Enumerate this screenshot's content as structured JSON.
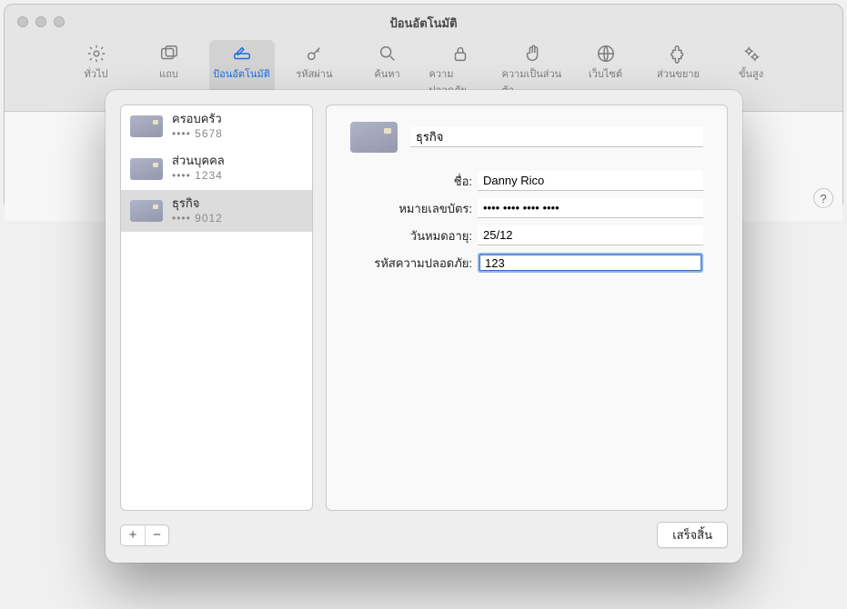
{
  "window": {
    "title": "ป้อนอัตโนมัติ"
  },
  "toolbar": {
    "items": [
      {
        "label": "ทั่วไป"
      },
      {
        "label": "แถบ"
      },
      {
        "label": "ป้อนอัตโนมัติ"
      },
      {
        "label": "รหัสผ่าน"
      },
      {
        "label": "ค้นหา"
      },
      {
        "label": "ความปลอดภัย"
      },
      {
        "label": "ความเป็นส่วนตัว"
      },
      {
        "label": "เว็บไซต์"
      },
      {
        "label": "ส่วนขยาย"
      },
      {
        "label": "ขั้นสูง"
      }
    ]
  },
  "help_glyph": "?",
  "cards": [
    {
      "name": "ครอบครัว",
      "last4": "5678"
    },
    {
      "name": "ส่วนบุคคล",
      "last4": "1234"
    },
    {
      "name": "ธุรกิจ",
      "last4": "9012"
    }
  ],
  "dots_prefix": "•••• ",
  "details": {
    "description": "ธุรกิจ",
    "name_label": "ชื่อ:",
    "name_value": "Danny Rico",
    "number_label": "หมายเลขบัตร:",
    "number_masked": "•••• •••• •••• ••••",
    "expiry_label": "วันหมดอายุ:",
    "expiry_value": "25/12",
    "cvc_label": "รหัสความปลอดภัย:",
    "cvc_value": "123"
  },
  "buttons": {
    "add": "+",
    "remove": "−",
    "done": "เสร็จสิ้น"
  }
}
